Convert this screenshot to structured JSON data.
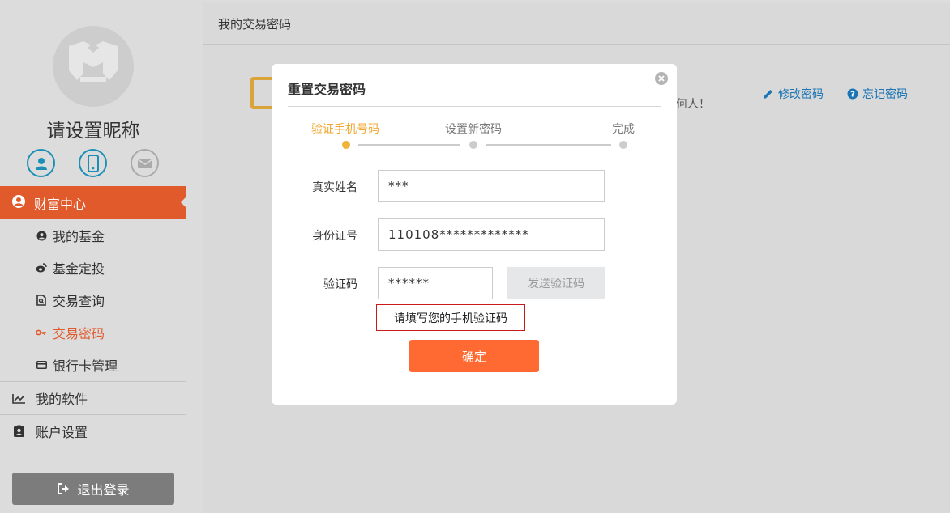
{
  "sidebar": {
    "nickname": "请设置昵称",
    "bind_icons": [
      "user-icon",
      "mobile-icon",
      "mail-icon"
    ],
    "menu_head": {
      "label": "财富中心",
      "icon": "user-circle-icon"
    },
    "submenu": [
      {
        "label": "我的基金",
        "icon": "user-circle-icon"
      },
      {
        "label": "基金定投",
        "icon": "weibo-icon"
      },
      {
        "label": "交易查询",
        "icon": "document-search-icon"
      },
      {
        "label": "交易密码",
        "icon": "key-icon"
      },
      {
        "label": "银行卡管理",
        "icon": "card-icon"
      }
    ],
    "menu_rows": [
      {
        "label": "我的软件",
        "icon": "chart-line-icon"
      },
      {
        "label": "账户设置",
        "icon": "id-card-icon"
      }
    ],
    "logout_label": "退出登录"
  },
  "main": {
    "title": "我的交易密码",
    "behind_text": "何人！",
    "links": {
      "modify": "修改密码",
      "forgot": "忘记密码"
    }
  },
  "modal": {
    "title": "重置交易密码",
    "steps": [
      "验证手机号码",
      "设置新密码",
      "完成"
    ],
    "active_step": 0,
    "fields": {
      "name_label": "真实姓名",
      "name_value": "***",
      "id_label": "身份证号",
      "id_value": "110108*************",
      "code_label": "验证码",
      "code_value": "******"
    },
    "send_code_label": "发送验证码",
    "error_text": "请填写您的手机验证码",
    "confirm_label": "确定"
  },
  "colors": {
    "accent_orange": "#e05a2b",
    "confirm_orange": "#ff6a33",
    "step_active": "#f0a830",
    "link_blue": "#1b75b5",
    "icon_teal": "#1b8fb5",
    "error_red": "#c91a1a"
  }
}
